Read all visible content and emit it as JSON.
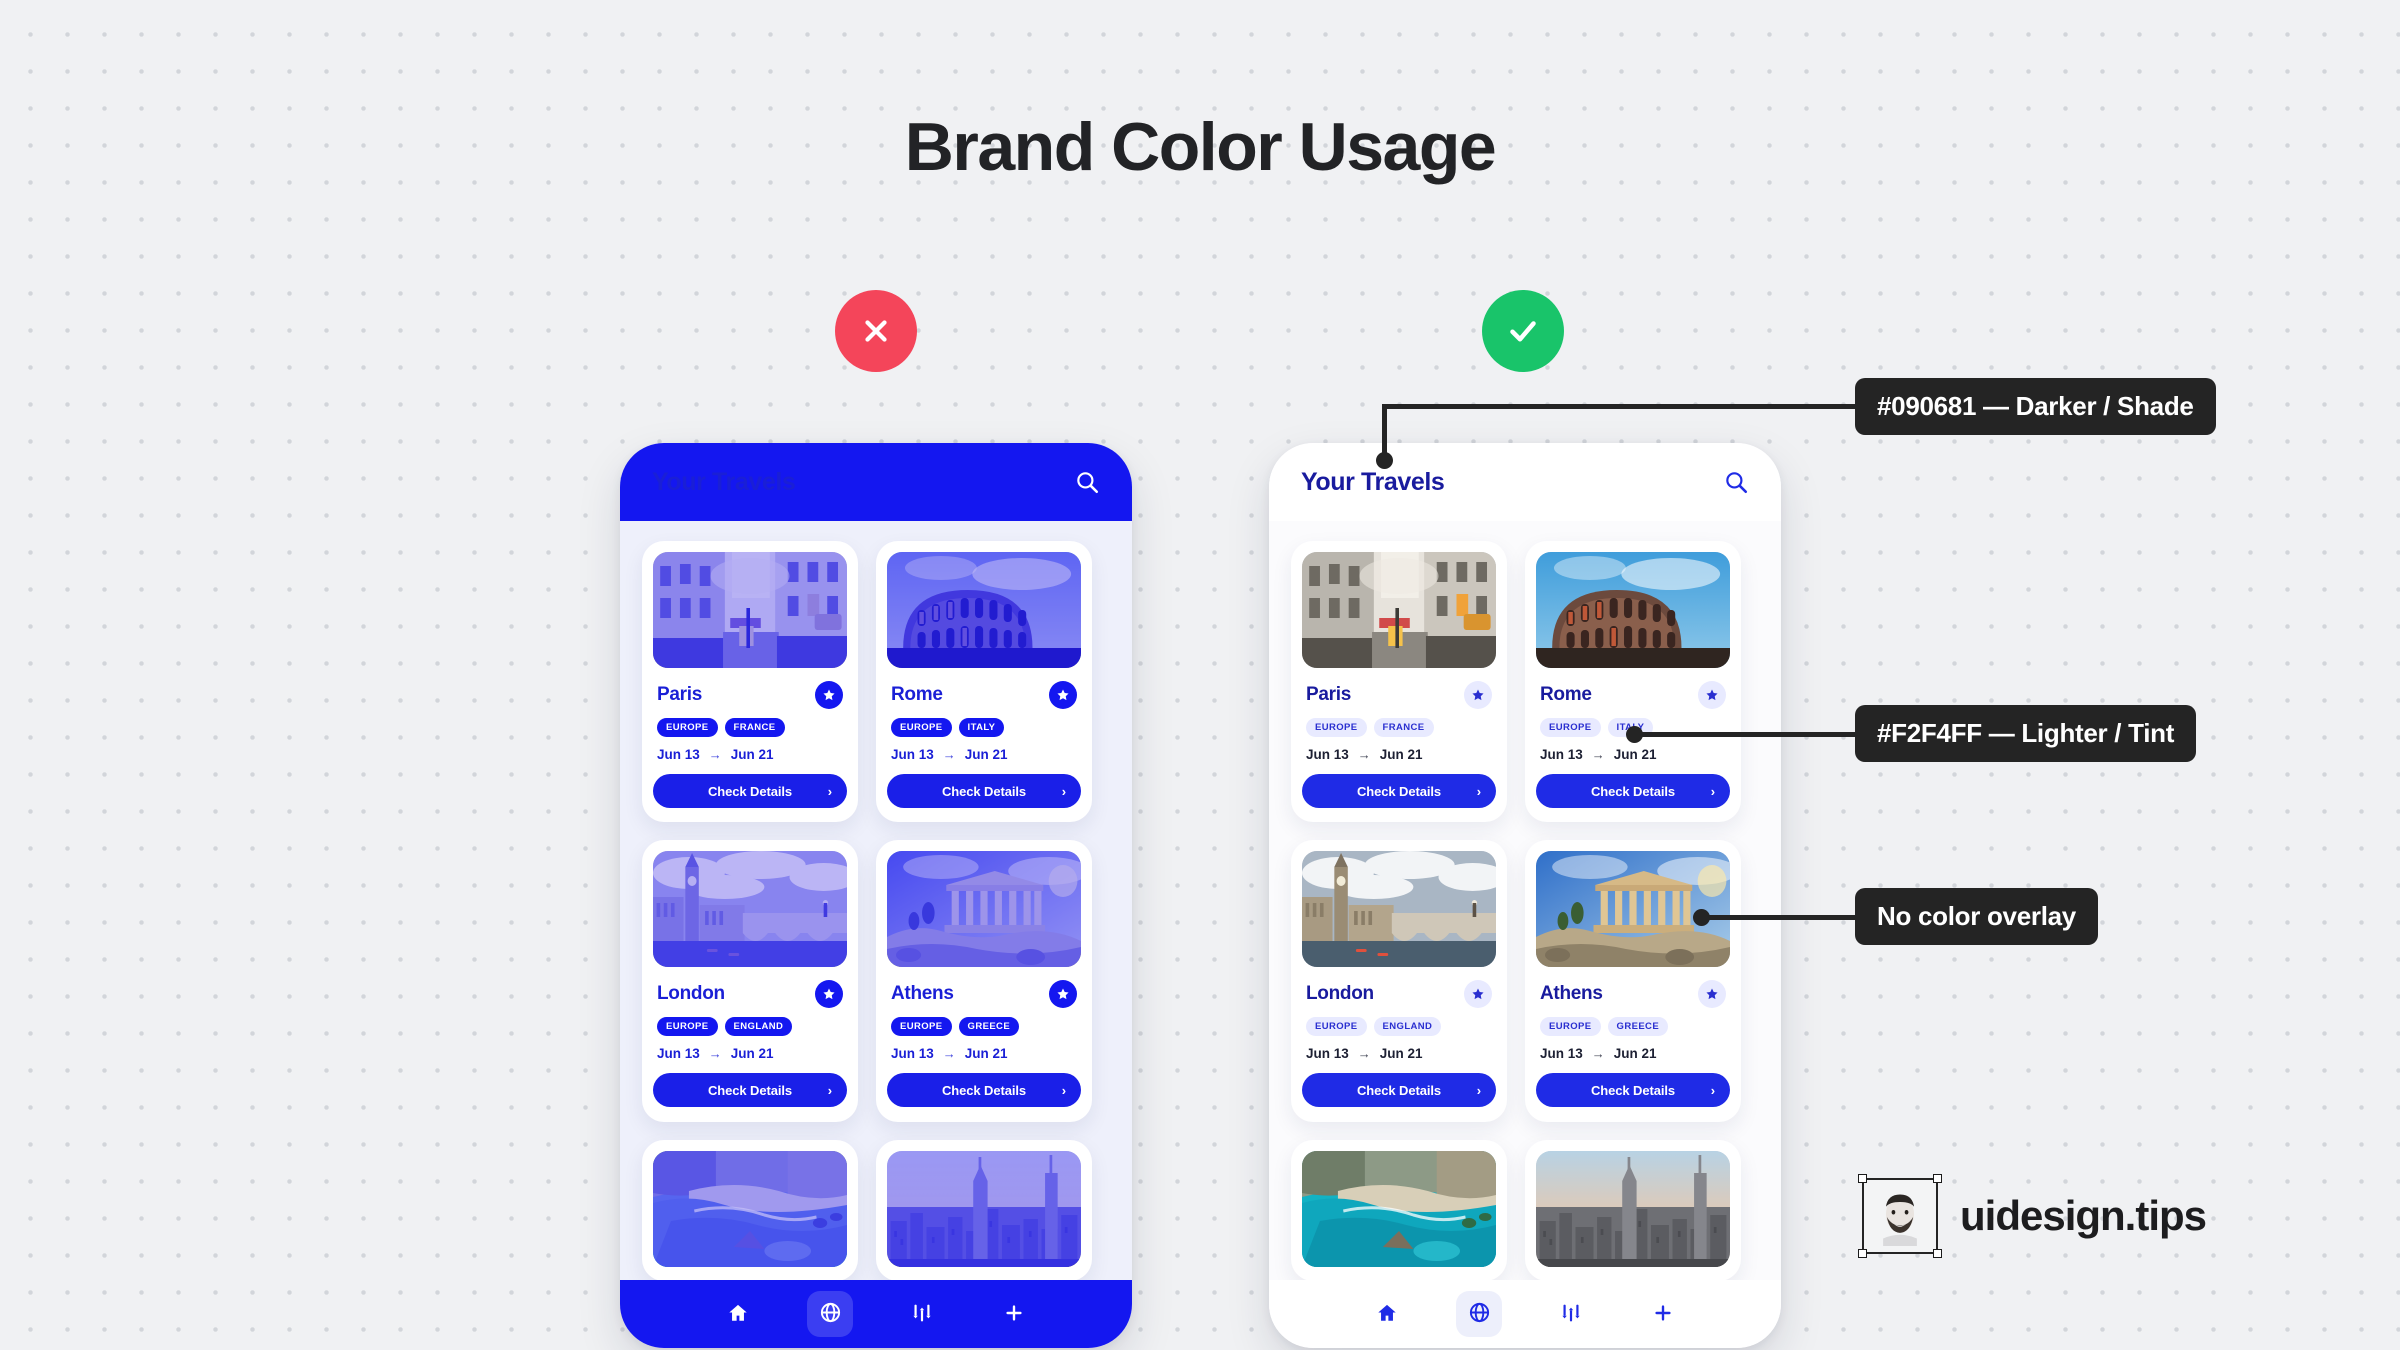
{
  "page": {
    "title": "Brand Color Usage",
    "bg_color": "#F0F1F3",
    "title_color": "#222326"
  },
  "verdicts": {
    "bad": {
      "icon": "cross-icon",
      "color": "#F4455A"
    },
    "good": {
      "icon": "check-icon",
      "color": "#19C46A"
    }
  },
  "phones": {
    "bad": {
      "header": {
        "title": "Your Travels",
        "search_icon": "search-icon"
      },
      "nav": [
        {
          "icon": "home-icon",
          "active": false
        },
        {
          "icon": "globe-icon",
          "active": true
        },
        {
          "icon": "sliders-icon",
          "active": false
        },
        {
          "icon": "plus-icon",
          "active": false
        }
      ]
    },
    "good": {
      "header": {
        "title": "Your Travels",
        "search_icon": "search-icon"
      },
      "nav": [
        {
          "icon": "home-icon",
          "active": false
        },
        {
          "icon": "globe-icon",
          "active": true
        },
        {
          "icon": "sliders-icon",
          "active": false
        },
        {
          "icon": "plus-icon",
          "active": false
        }
      ]
    }
  },
  "cards": [
    {
      "name": "Paris",
      "tags": [
        "EUROPE",
        "FRANCE"
      ],
      "date_from": "Jun 13",
      "arrow": "→",
      "date_to": "Jun 21",
      "cta": "Check Details",
      "cta_chevron": "›",
      "star": "star-icon",
      "image": "paris-street"
    },
    {
      "name": "Rome",
      "tags": [
        "EUROPE",
        "ITALY"
      ],
      "date_from": "Jun 13",
      "arrow": "→",
      "date_to": "Jun 21",
      "cta": "Check Details",
      "cta_chevron": "›",
      "star": "star-icon",
      "image": "rome-colosseum"
    },
    {
      "name": "London",
      "tags": [
        "EUROPE",
        "ENGLAND"
      ],
      "date_from": "Jun 13",
      "arrow": "→",
      "date_to": "Jun 21",
      "cta": "Check Details",
      "cta_chevron": "›",
      "star": "star-icon",
      "image": "london-bigben"
    },
    {
      "name": "Athens",
      "tags": [
        "EUROPE",
        "GREECE"
      ],
      "date_from": "Jun 13",
      "arrow": "→",
      "date_to": "Jun 21",
      "cta": "Check Details",
      "cta_chevron": "›",
      "star": "star-icon",
      "image": "athens-parthenon"
    }
  ],
  "cards_partial": [
    {
      "image": "beach-cove"
    },
    {
      "image": "nyc-skyline"
    }
  ],
  "annotations": [
    {
      "text": "#090681 — Darker / Shade",
      "color": "#090681"
    },
    {
      "text": "#F2F4FF — Lighter / Tint",
      "color": "#F2F4FF"
    },
    {
      "text": "No color overlay",
      "color": ""
    }
  ],
  "watermark": {
    "text": "uidesign.tips",
    "avatar": "avatar-face"
  }
}
